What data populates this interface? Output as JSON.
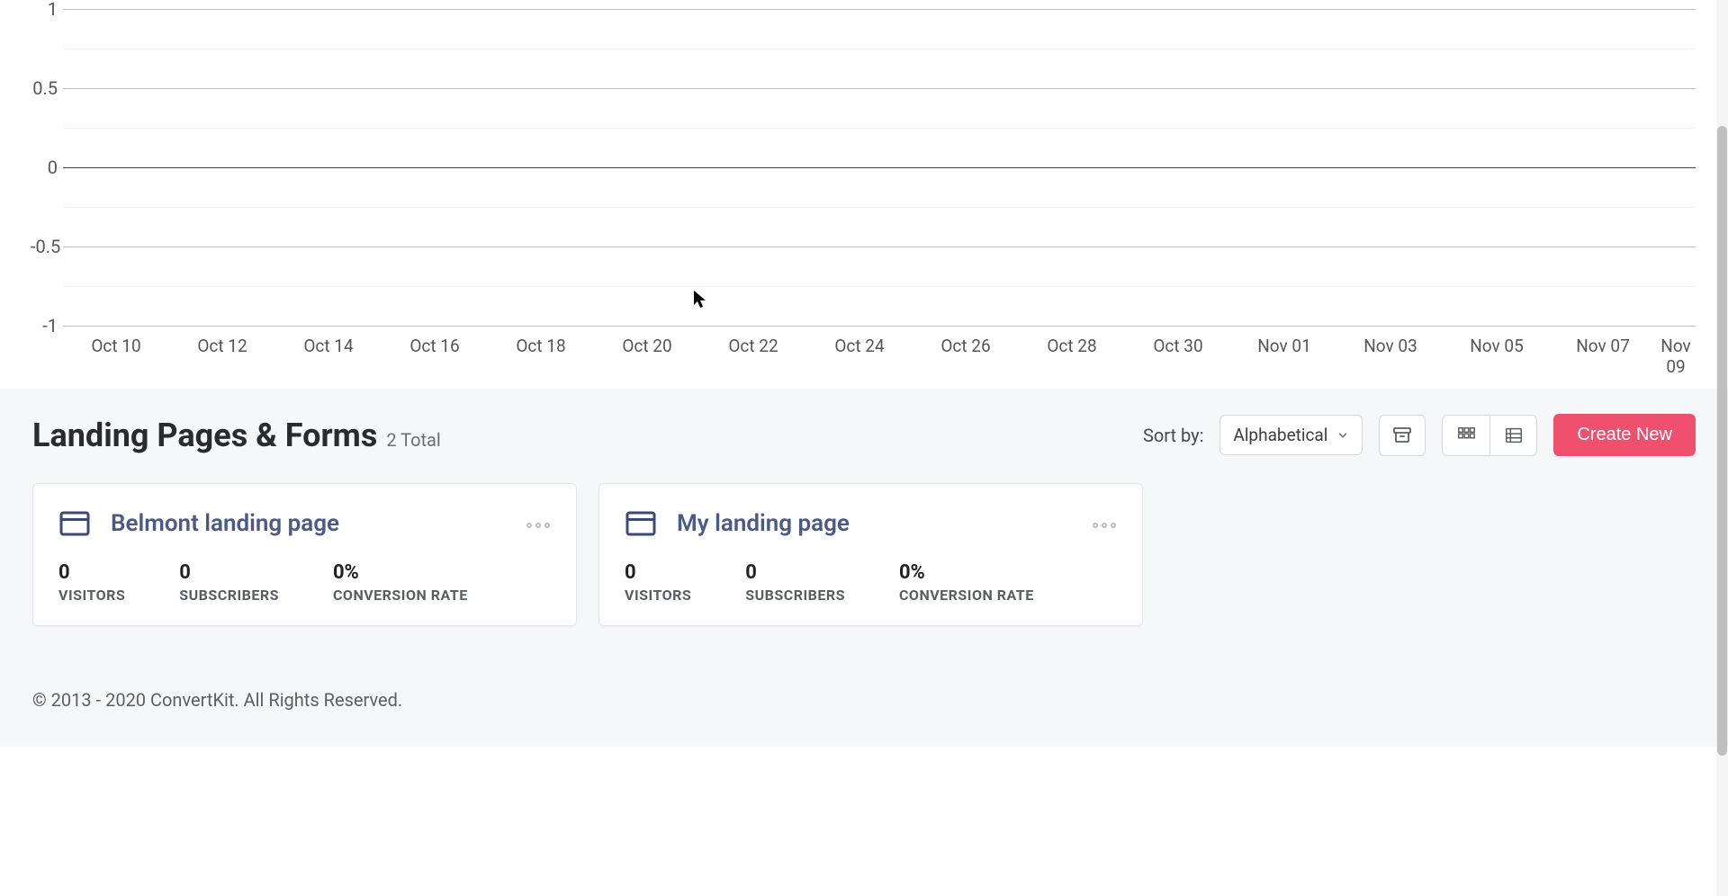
{
  "chart_data": {
    "type": "line",
    "title": "",
    "xlabel": "",
    "ylabel": "",
    "ylim": [
      -1,
      1
    ],
    "y_ticks": [
      -1,
      -0.5,
      0,
      0.5,
      1
    ],
    "categories": [
      "Oct 10",
      "Oct 12",
      "Oct 14",
      "Oct 16",
      "Oct 18",
      "Oct 20",
      "Oct 22",
      "Oct 24",
      "Oct 26",
      "Oct 28",
      "Oct 30",
      "Nov 01",
      "Nov 03",
      "Nov 05",
      "Nov 07",
      "Nov 09"
    ],
    "series": [
      {
        "name": "value",
        "values": [
          0,
          0,
          0,
          0,
          0,
          0,
          0,
          0,
          0,
          0,
          0,
          0,
          0,
          0,
          0,
          0
        ]
      }
    ]
  },
  "section": {
    "title": "Landing Pages & Forms",
    "count_text": "2 Total"
  },
  "toolbar": {
    "sort_by_label": "Sort by:",
    "sort_value": "Alphabetical",
    "create_new_label": "Create New"
  },
  "cards": [
    {
      "title": "Belmont landing page",
      "stats": {
        "visitors_value": "0",
        "visitors_label": "VISITORS",
        "subscribers_value": "0",
        "subscribers_label": "SUBSCRIBERS",
        "conversion_value": "0%",
        "conversion_label": "CONVERSION RATE"
      }
    },
    {
      "title": "My landing page",
      "stats": {
        "visitors_value": "0",
        "visitors_label": "VISITORS",
        "subscribers_value": "0",
        "subscribers_label": "SUBSCRIBERS",
        "conversion_value": "0%",
        "conversion_label": "CONVERSION RATE"
      }
    }
  ],
  "footer": {
    "copyright": "© 2013 - 2020 ConvertKit. All Rights Reserved."
  },
  "icons": {
    "chevron_down": "chevron-down-icon",
    "archive": "archive-icon",
    "grid": "grid-icon",
    "list": "list-icon",
    "browser": "browser-icon",
    "more": "more-icon"
  },
  "colors": {
    "primary": "#ef506e",
    "link": "#4a5a86",
    "grid_major": "#bfbfbf",
    "grid_minor": "#e5e5e5"
  }
}
